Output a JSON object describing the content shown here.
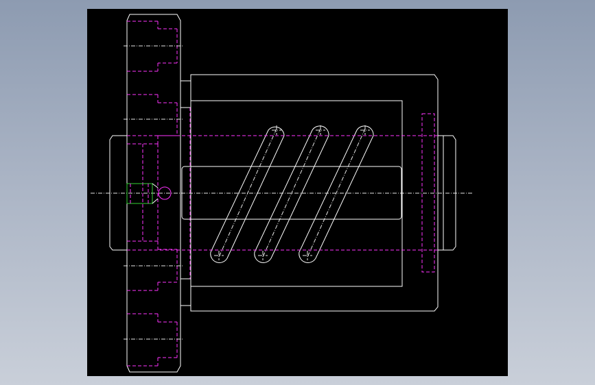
{
  "drawing": {
    "colors": {
      "background": "#000000",
      "outline": "#ffffff",
      "hidden_lines": "#ff33ff",
      "highlight": "#35d035",
      "window_gradient_top": "#8d9bb1",
      "window_gradient_bottom": "#c9cfd9"
    },
    "views": [
      "cam-drum-front-view"
    ],
    "line_styles": [
      "continuous",
      "hidden-dashed",
      "center-dash-dot"
    ]
  }
}
